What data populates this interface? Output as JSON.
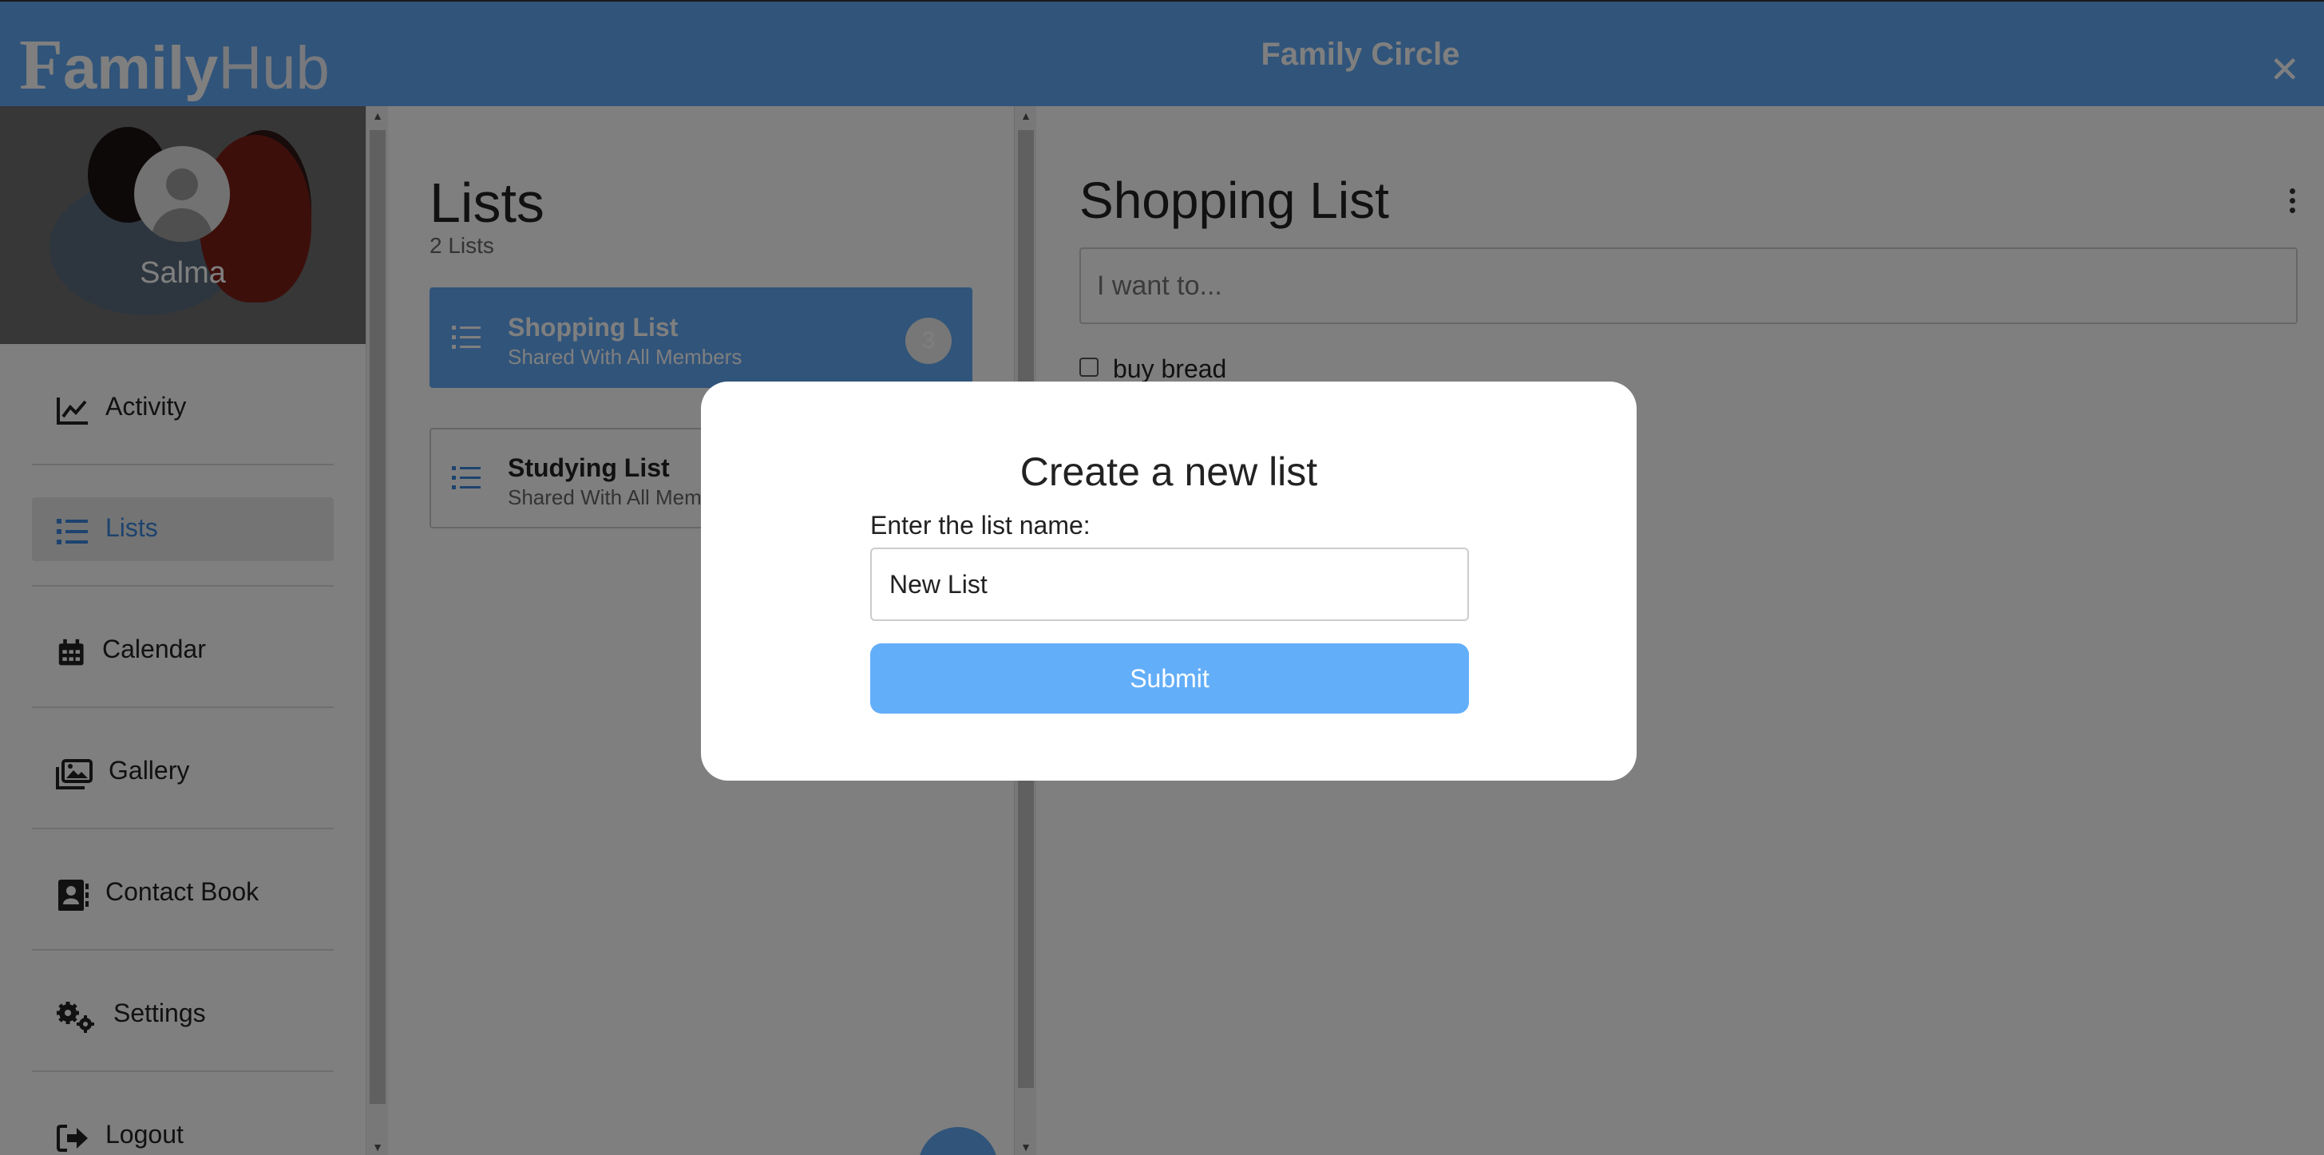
{
  "header": {
    "logo_first": "F",
    "logo_mid": "amily",
    "logo_end": "Hub",
    "title": "Family Circle",
    "close_glyph": "✕"
  },
  "profile": {
    "name": "Salma"
  },
  "sidebar": {
    "items": [
      {
        "label": "Activity",
        "icon": "chart-line-icon"
      },
      {
        "label": "Lists",
        "icon": "list-icon",
        "active": true
      },
      {
        "label": "Calendar",
        "icon": "calendar-icon"
      },
      {
        "label": "Gallery",
        "icon": "images-icon"
      },
      {
        "label": "Contact Book",
        "icon": "address-book-icon"
      },
      {
        "label": "Settings",
        "icon": "gears-icon"
      },
      {
        "label": "Logout",
        "icon": "sign-out-icon"
      }
    ]
  },
  "lists": {
    "title": "Lists",
    "count": "2 Lists",
    "items": [
      {
        "name": "Shopping List",
        "subtitle": "Shared With All Members",
        "badge": "3",
        "active": true
      },
      {
        "name": "Studying List",
        "subtitle": "Shared With All Mem"
      }
    ]
  },
  "detail": {
    "title": "Shopping List",
    "input_placeholder": "I want to...",
    "items": [
      {
        "text": "buy bread",
        "checked": false
      }
    ]
  },
  "modal": {
    "title": "Create a new list",
    "label": "Enter the list name:",
    "input_value": "New List",
    "submit_label": "Submit"
  },
  "colors": {
    "brand": "#62a8f5",
    "active_text": "#3a87dc",
    "submit": "#63aef9"
  }
}
